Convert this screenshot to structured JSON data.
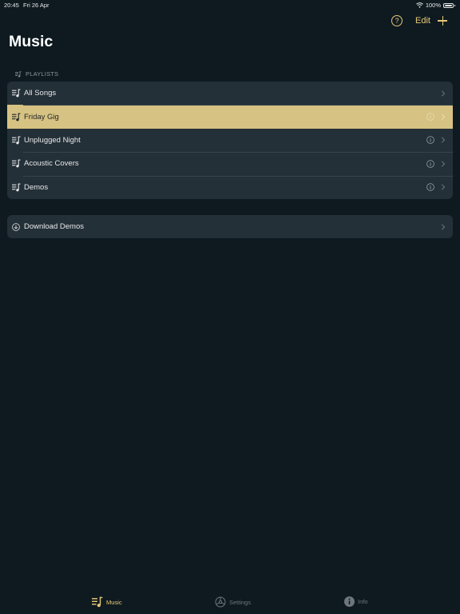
{
  "status_bar": {
    "time": "20:45",
    "date": "Fri 26 Apr",
    "battery": "100%"
  },
  "nav": {
    "help_label": "?",
    "edit_label": "Edit"
  },
  "page_title": "Music",
  "playlists": {
    "header": "PLAYLISTS",
    "items": [
      {
        "label": "All Songs",
        "has_info": false,
        "selected": false
      },
      {
        "label": "Friday Gig",
        "has_info": true,
        "selected": true
      },
      {
        "label": "Unplugged Night",
        "has_info": true,
        "selected": false
      },
      {
        "label": "Acoustic Covers",
        "has_info": true,
        "selected": false
      },
      {
        "label": "Demos",
        "has_info": true,
        "selected": false
      }
    ]
  },
  "downloads": {
    "label": "Download Demos"
  },
  "tabs": [
    {
      "label": "Music",
      "icon": "playlist-icon",
      "active": true
    },
    {
      "label": "Settings",
      "icon": "gear-icon",
      "active": false
    },
    {
      "label": "Info",
      "icon": "info-icon",
      "active": false
    }
  ],
  "colors": {
    "background": "#0e1a20",
    "cell": "#243037",
    "accent": "#e8c877",
    "selected_row": "#d6c282",
    "secondary_text": "#8d949a"
  }
}
